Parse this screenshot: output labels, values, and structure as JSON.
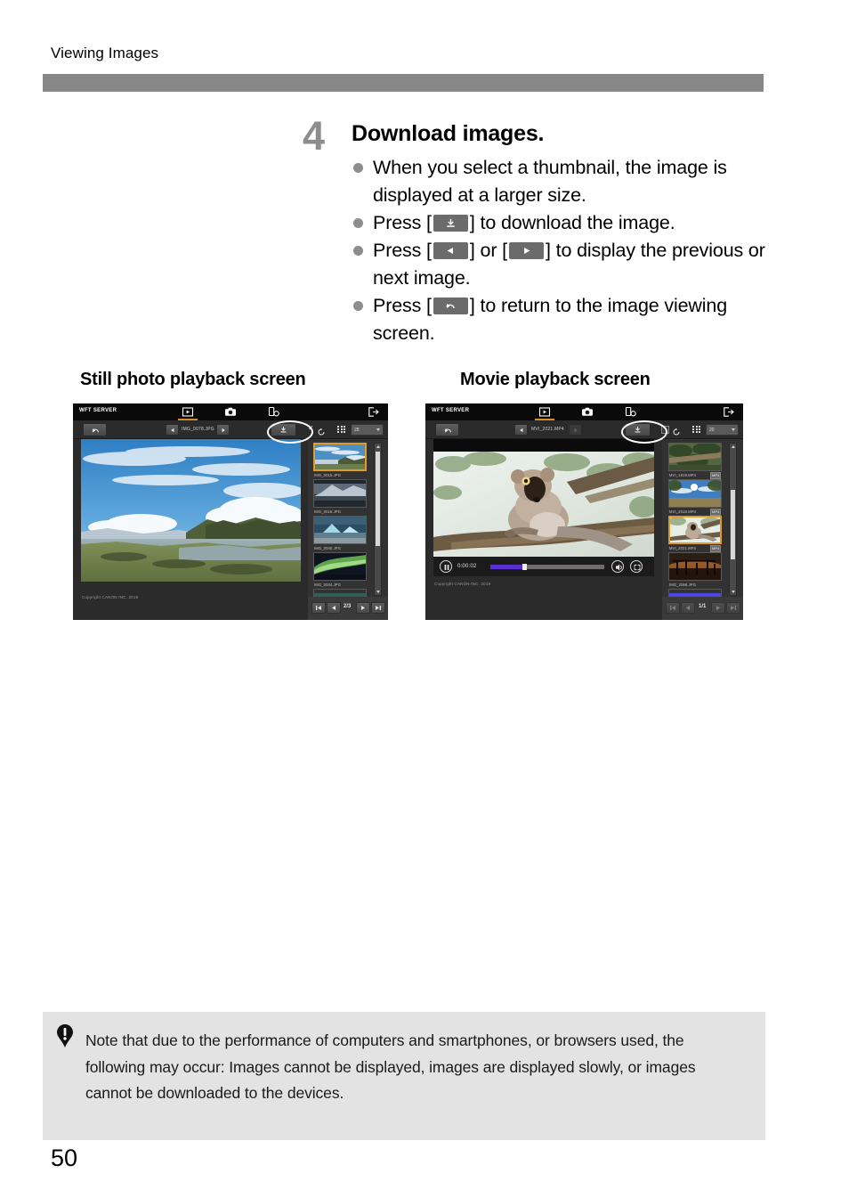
{
  "running_head": "Viewing Images",
  "page_number": "50",
  "step": {
    "number": "4",
    "title": "Download images.",
    "bullets": [
      {
        "before": "When you select a thumbnail, the image is displayed at a larger size.",
        "keys": []
      },
      {
        "before": "Press [",
        "key1": "download-icon",
        "mid": "] to download the image.",
        "keys": [
          "download"
        ]
      },
      {
        "before": "Press [",
        "key1": "prev-icon",
        "mid": "] or [",
        "key2": "next-icon",
        "after": "] to display the previous or next image.",
        "keys": [
          "prev",
          "next"
        ]
      },
      {
        "before": "Press [",
        "key1": "return-icon",
        "mid": "] to return to the image viewing screen.",
        "keys": [
          "return"
        ]
      }
    ],
    "bullet_1_text": "When you select a thumbnail, the image is displayed at a larger size.",
    "bullet_2_pre": "Press [",
    "bullet_2_post": "] to download the image.",
    "bullet_3_pre": "Press [",
    "bullet_3_mid": "] or [",
    "bullet_3_post": "] to display the previous or next image.",
    "bullet_4_pre": "Press [",
    "bullet_4_post": "] to return to the image viewing screen."
  },
  "figures": {
    "still_caption": "Still photo playback screen",
    "movie_caption": "Movie playback screen"
  },
  "wft_ui": {
    "app_title": "WFT SERVER",
    "header_tabs": [
      "playback-tab-icon",
      "capture-tab-icon",
      "remote-tab-icon"
    ],
    "exit_icon": "exit-icon",
    "active_tab_index": 0,
    "accent_color": "#d98b28",
    "seek_color": "#5b2fd4"
  },
  "still_screen": {
    "back_button": "return-icon",
    "prev_button": "prev-icon",
    "filename": "IMG_0078.JPG",
    "next_button": "next-icon",
    "download_button": "download-icon",
    "refresh_checkbox_checked": true,
    "refresh_button": "refresh-icon",
    "grid_icon": "grid-icon",
    "thumb_count": "28",
    "copyright": "Copyright CANON INC. 2019",
    "thumbnails": [
      {
        "name": "IMG_0015.JPG",
        "selected": true
      },
      {
        "name": "IMG_0016.JPG",
        "selected": false
      },
      {
        "name": "IMG_0040.JPG",
        "selected": false
      },
      {
        "name": "IMG_0044.JPG",
        "selected": false
      }
    ],
    "pager": "2/3",
    "pager_buttons": [
      "first-icon",
      "prev-icon",
      "next-icon",
      "last-icon"
    ]
  },
  "movie_screen": {
    "back_button": "return-icon",
    "prev_button": "prev-icon",
    "filename": "MVI_2021.MP4",
    "next_button": "next-icon",
    "download_button": "download-icon",
    "refresh_checkbox_checked": false,
    "refresh_button": "refresh-icon",
    "grid_icon": "grid-icon",
    "thumb_count": "20",
    "copyright": "Copyright CANON INC. 2019",
    "playback": {
      "pause_button": "pause-icon",
      "time": "0:00:02",
      "volume_button": "volume-icon",
      "fullscreen_button": "fullscreen-icon",
      "progress_percent": 28
    },
    "thumbnails": [
      {
        "name": "MVI_1919.MP4",
        "badge": "MP4",
        "selected": false
      },
      {
        "name": "MVI_2018.MP4",
        "badge": "MP4",
        "selected": false
      },
      {
        "name": "MVI_2021.MP4",
        "badge": "MP4",
        "selected": true
      },
      {
        "name": "IMG_2068.JPG",
        "badge": "",
        "selected": false
      }
    ],
    "pager": "1/1",
    "pager_buttons": [
      "first-icon",
      "prev-icon",
      "next-icon",
      "last-icon"
    ]
  },
  "note": {
    "icon": "caution-icon",
    "text": "Note that due to the performance of computers and smartphones, or browsers used, the following may occur: Images cannot be displayed, images are displayed slowly, or images cannot be downloaded to the devices."
  }
}
